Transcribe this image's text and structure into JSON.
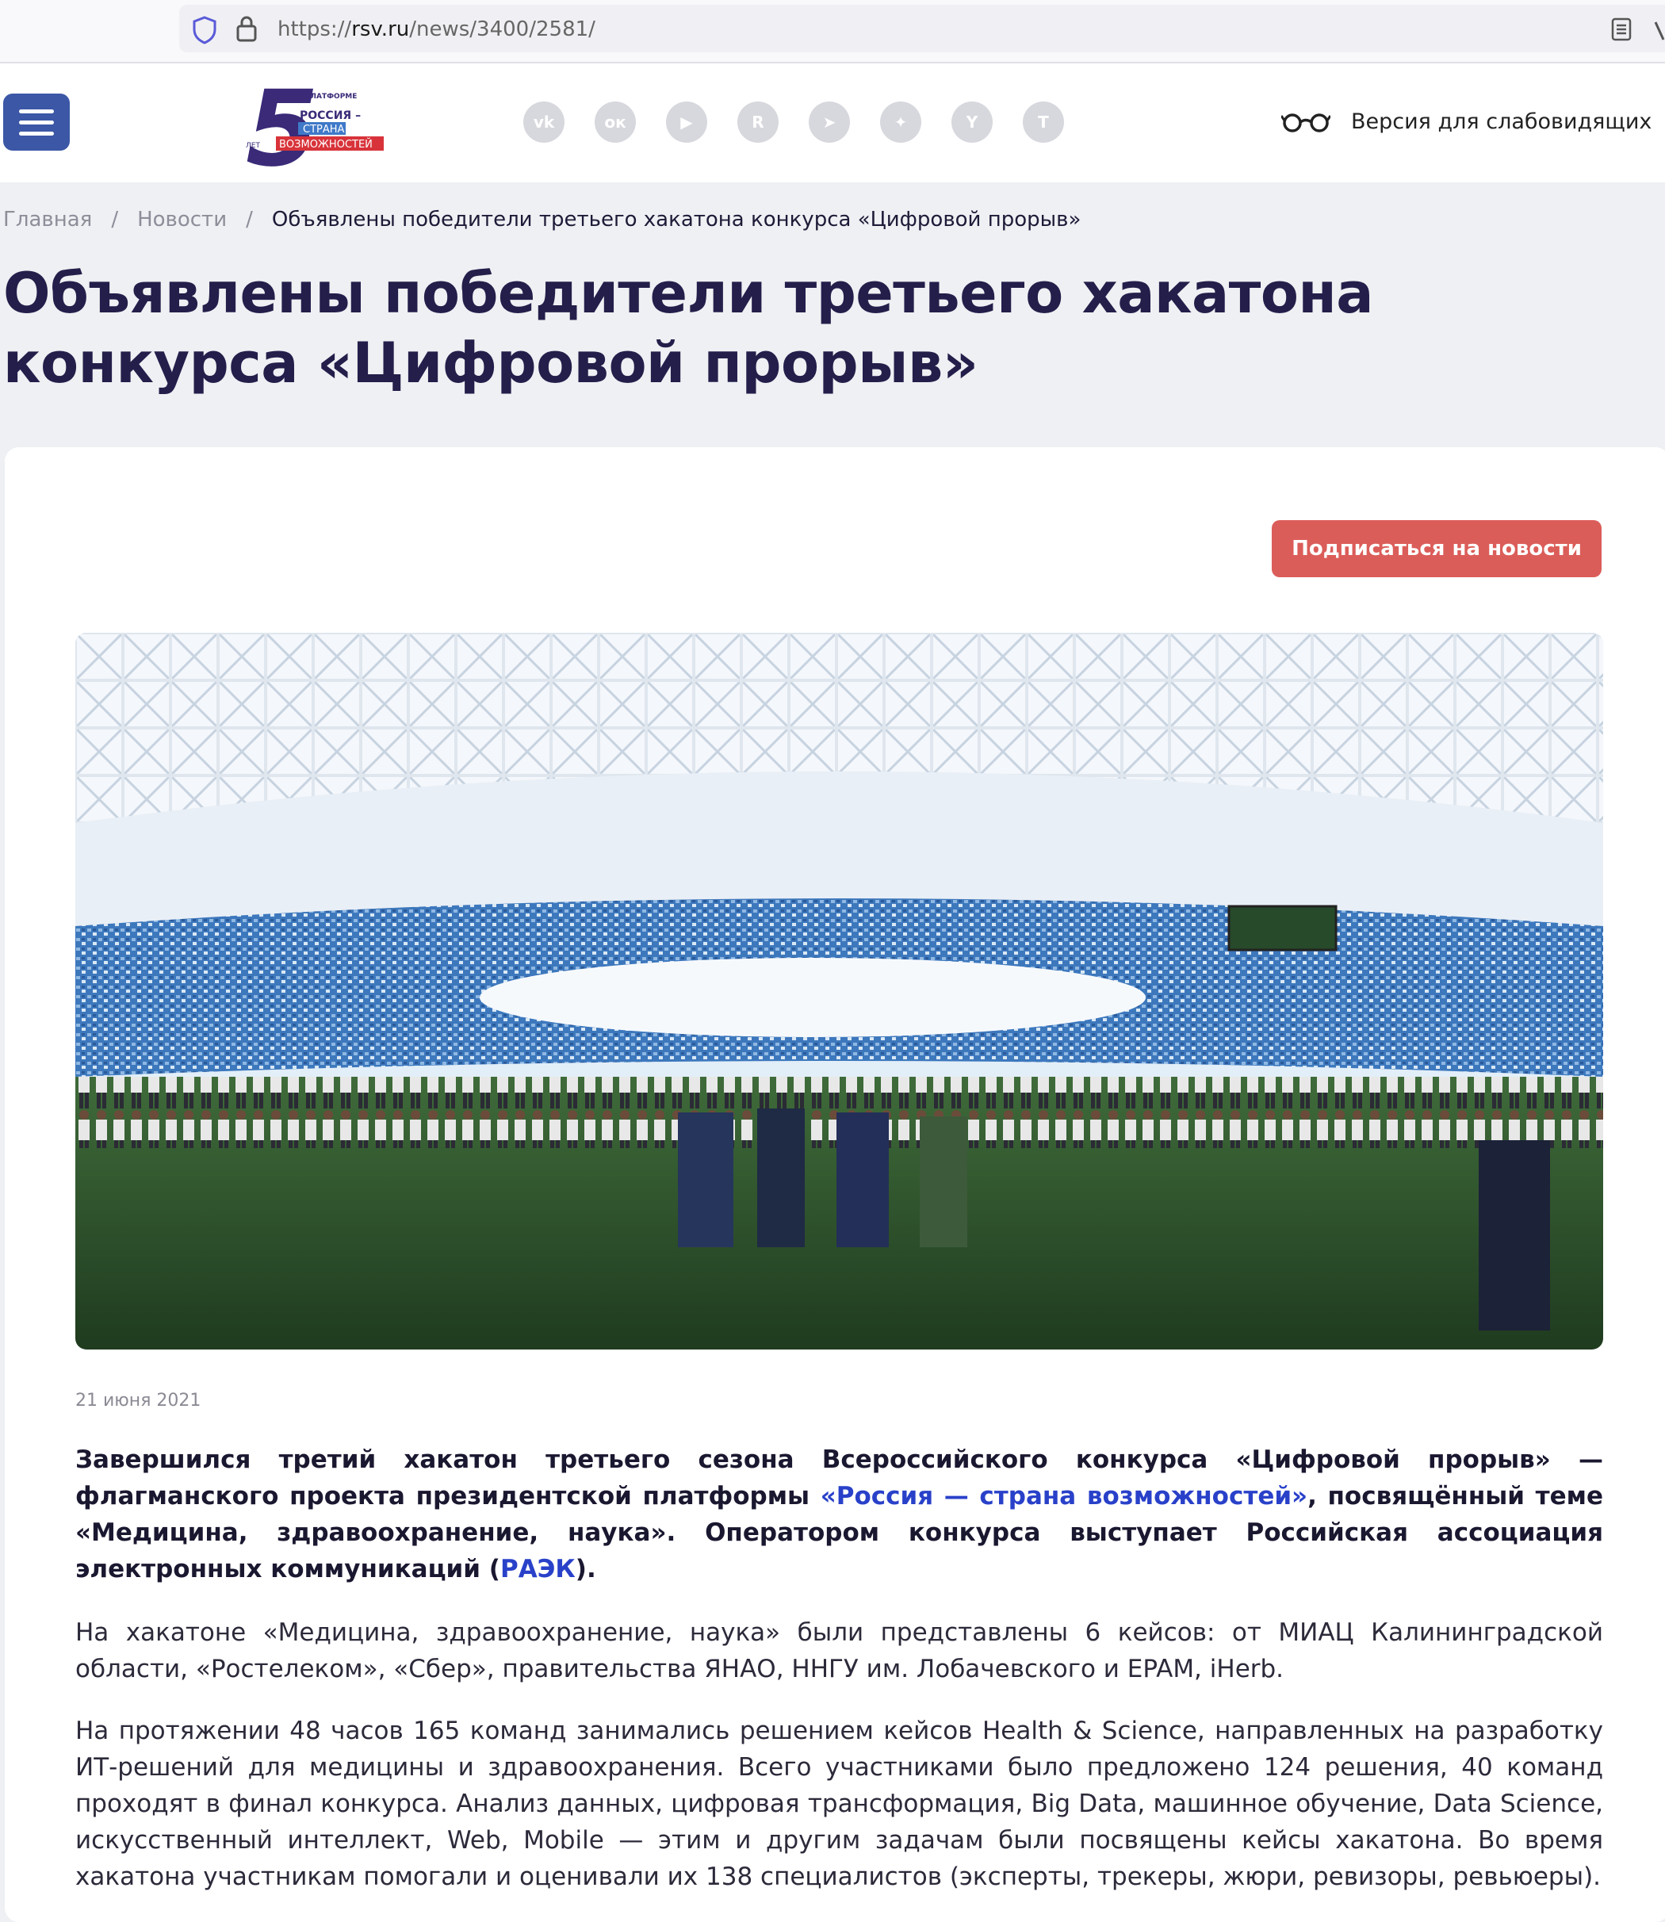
{
  "browser": {
    "url_prefix": "https://",
    "url_host": "rsv.ru",
    "url_path": "/news/3400/2581/"
  },
  "header": {
    "logo": {
      "number": "5",
      "line_top": "ПЛАТФОРМЕ",
      "line1": "РОССИЯ –",
      "line2": "СТРАНА",
      "line3": "ВОЗМОЖНОСТЕЙ",
      "prefix": "ЛЕТ"
    },
    "socials": [
      {
        "name": "vk",
        "glyph": "vk"
      },
      {
        "name": "odnoklassniki",
        "glyph": "ок"
      },
      {
        "name": "youtube",
        "glyph": "▶"
      },
      {
        "name": "rutube",
        "glyph": "R"
      },
      {
        "name": "telegram",
        "glyph": "➤"
      },
      {
        "name": "dzen",
        "glyph": "✦"
      },
      {
        "name": "yappy",
        "glyph": "Y"
      },
      {
        "name": "tenchat",
        "glyph": "T"
      }
    ],
    "accessibility_label": "Версия для слабовидящих"
  },
  "breadcrumb": {
    "home": "Главная",
    "section": "Новости",
    "current": "Объявлены победители третьего хакатона конкурса «Цифровой прорыв»"
  },
  "title": "Объявлены победители третьего хакатона конкурса «Цифровой прорыв»",
  "subscribe_label": "Подписаться на новости",
  "date": "21 июня 2021",
  "lead": {
    "part1": "Завершился третий хакатон третьего сезона Всероссийского конкурса «Цифровой прорыв» — флагманского проекта президентской платформы ",
    "link1": "«Россия — страна возможностей»",
    "part2": ", посвящённый теме «Медицина, здравоохранение, наука». Оператором конкурса выступает Российская ассоциация электронных коммуникаций (",
    "link2": "РАЭК",
    "part3": ")."
  },
  "paragraph1": "На хакатоне «Медицина, здравоохранение, наука» были представлены 6 кейсов: от МИАЦ Калининградской области, «Ростелеком», «Сбер», правительства ЯНАО, ННГУ им. Лобачевского и EPAM, iHerb.",
  "paragraph2": "На протяжении 48 часов 165 команд занимались решением кейсов Health & Science, направленных на разработку ИТ-решений для медицины и здравоохранения. Всего участниками было предложено 124 решения, 40 команд проходят в финал конкурса. Анализ данных, цифровая трансформация, Big Data, машинное обучение, Data Science, искусственный интеллект, Web, Mobile — этим и другим задачам были посвящены кейсы хакатона. Во время хакатона участникам помогали и оценивали их 138 специалистов (эксперты, трекеры, жюри, ревизоры, ревьюеры).",
  "colors": {
    "menu_button": "#3b57a6",
    "subscribe_button": "#db5d59",
    "link": "#2941c9",
    "title": "#231e4a"
  }
}
